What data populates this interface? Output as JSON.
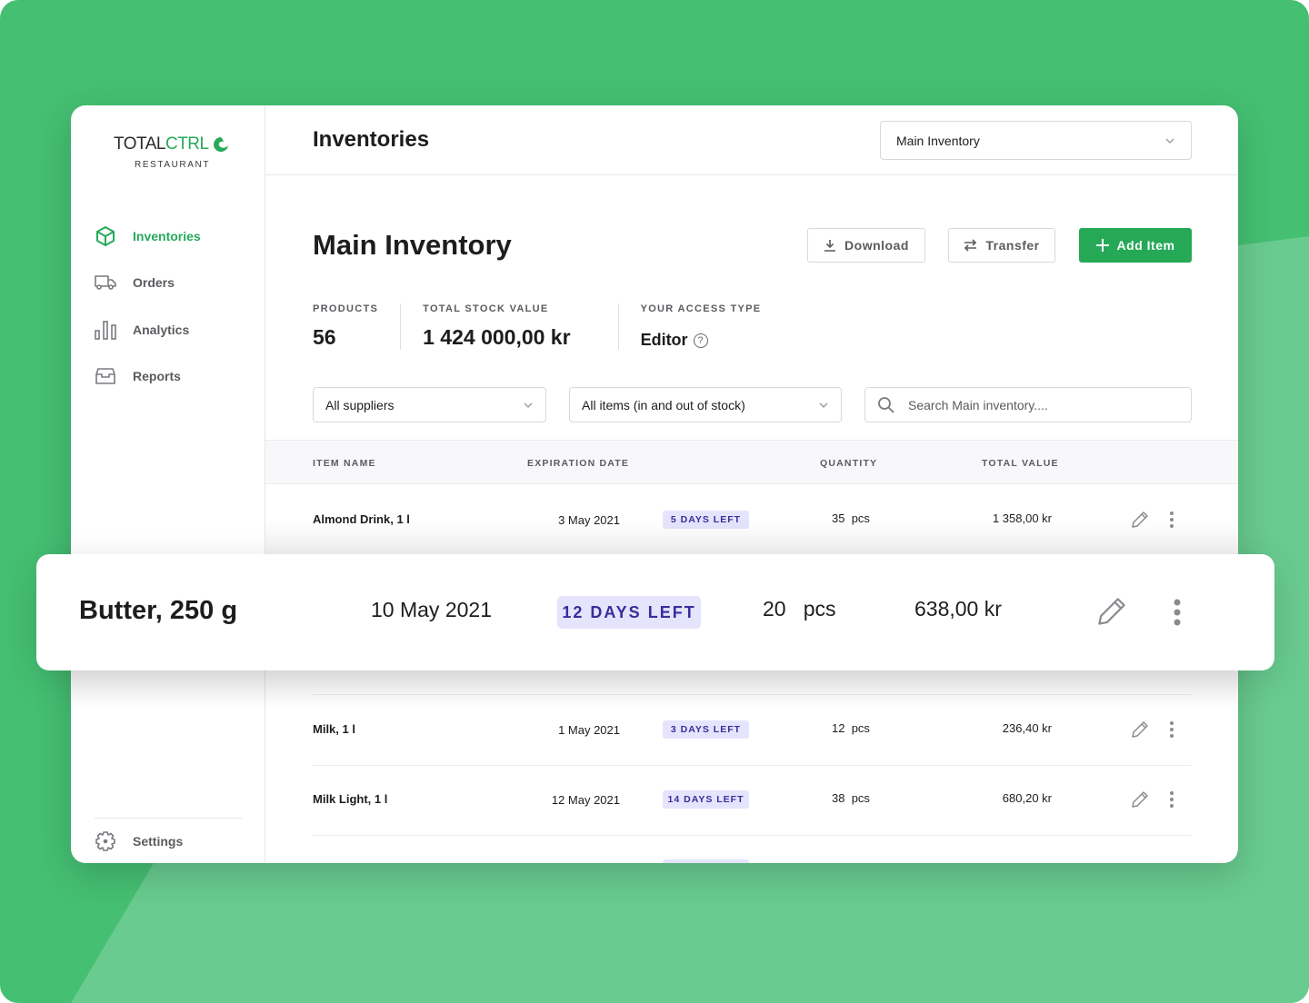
{
  "brand": {
    "name_part1": "TOTAL",
    "name_part2": "CTRL",
    "subtitle": "RESTAURANT"
  },
  "colors": {
    "accent": "#25a957",
    "background_green": "#45bf72",
    "badge_bg": "#e6e4fd",
    "badge_text": "#3a2d9a"
  },
  "sidebar": {
    "items": [
      {
        "label": "Inventories",
        "icon": "cube-icon",
        "active": true
      },
      {
        "label": "Orders",
        "icon": "truck-icon",
        "active": false
      },
      {
        "label": "Analytics",
        "icon": "bar-chart-icon",
        "active": false
      },
      {
        "label": "Reports",
        "icon": "inbox-tray-icon",
        "active": false
      }
    ],
    "settings_label": "Settings"
  },
  "topbar": {
    "title": "Inventories",
    "inventory_select": "Main Inventory"
  },
  "page": {
    "title": "Main Inventory",
    "buttons": {
      "download": "Download",
      "transfer": "Transfer",
      "add_item": "Add Item"
    },
    "stats": {
      "products_label": "PRODUCTS",
      "products_value": "56",
      "stock_value_label": "TOTAL STOCK VALUE",
      "stock_value": "1 424 000,00 kr",
      "access_label": "YOUR ACCESS TYPE",
      "access_value": "Editor",
      "help_glyph": "?"
    },
    "filters": {
      "supplier": "All suppliers",
      "stock": "All items (in and out of stock)",
      "search_placeholder": "Search Main inventory...."
    }
  },
  "table": {
    "headers": {
      "name": "ITEM NAME",
      "expiration": "EXPIRATION DATE",
      "quantity": "QUANTITY",
      "total": "TOTAL VALUE"
    },
    "rows": [
      {
        "name": "Almond Drink, 1 l",
        "date": "3 May 2021",
        "badge": "5 DAYS LEFT",
        "qty": "35",
        "unit": "pcs",
        "total": "1 358,00 kr"
      },
      {
        "name": "Butter, 250 g",
        "date": "10 May 2021",
        "badge": "12 DAYS LEFT",
        "qty": "20",
        "unit": "pcs",
        "total": "638,00 kr"
      },
      {
        "name": "Milk, 1 l",
        "date": "1 May 2021",
        "badge": "3 DAYS LEFT",
        "qty": "12",
        "unit": "pcs",
        "total": "236,40 kr"
      },
      {
        "name": "Milk Light, 1 l",
        "date": "12 May 2021",
        "badge": "14 DAYS LEFT",
        "qty": "38",
        "unit": "pcs",
        "total": "680,20 kr"
      }
    ]
  }
}
